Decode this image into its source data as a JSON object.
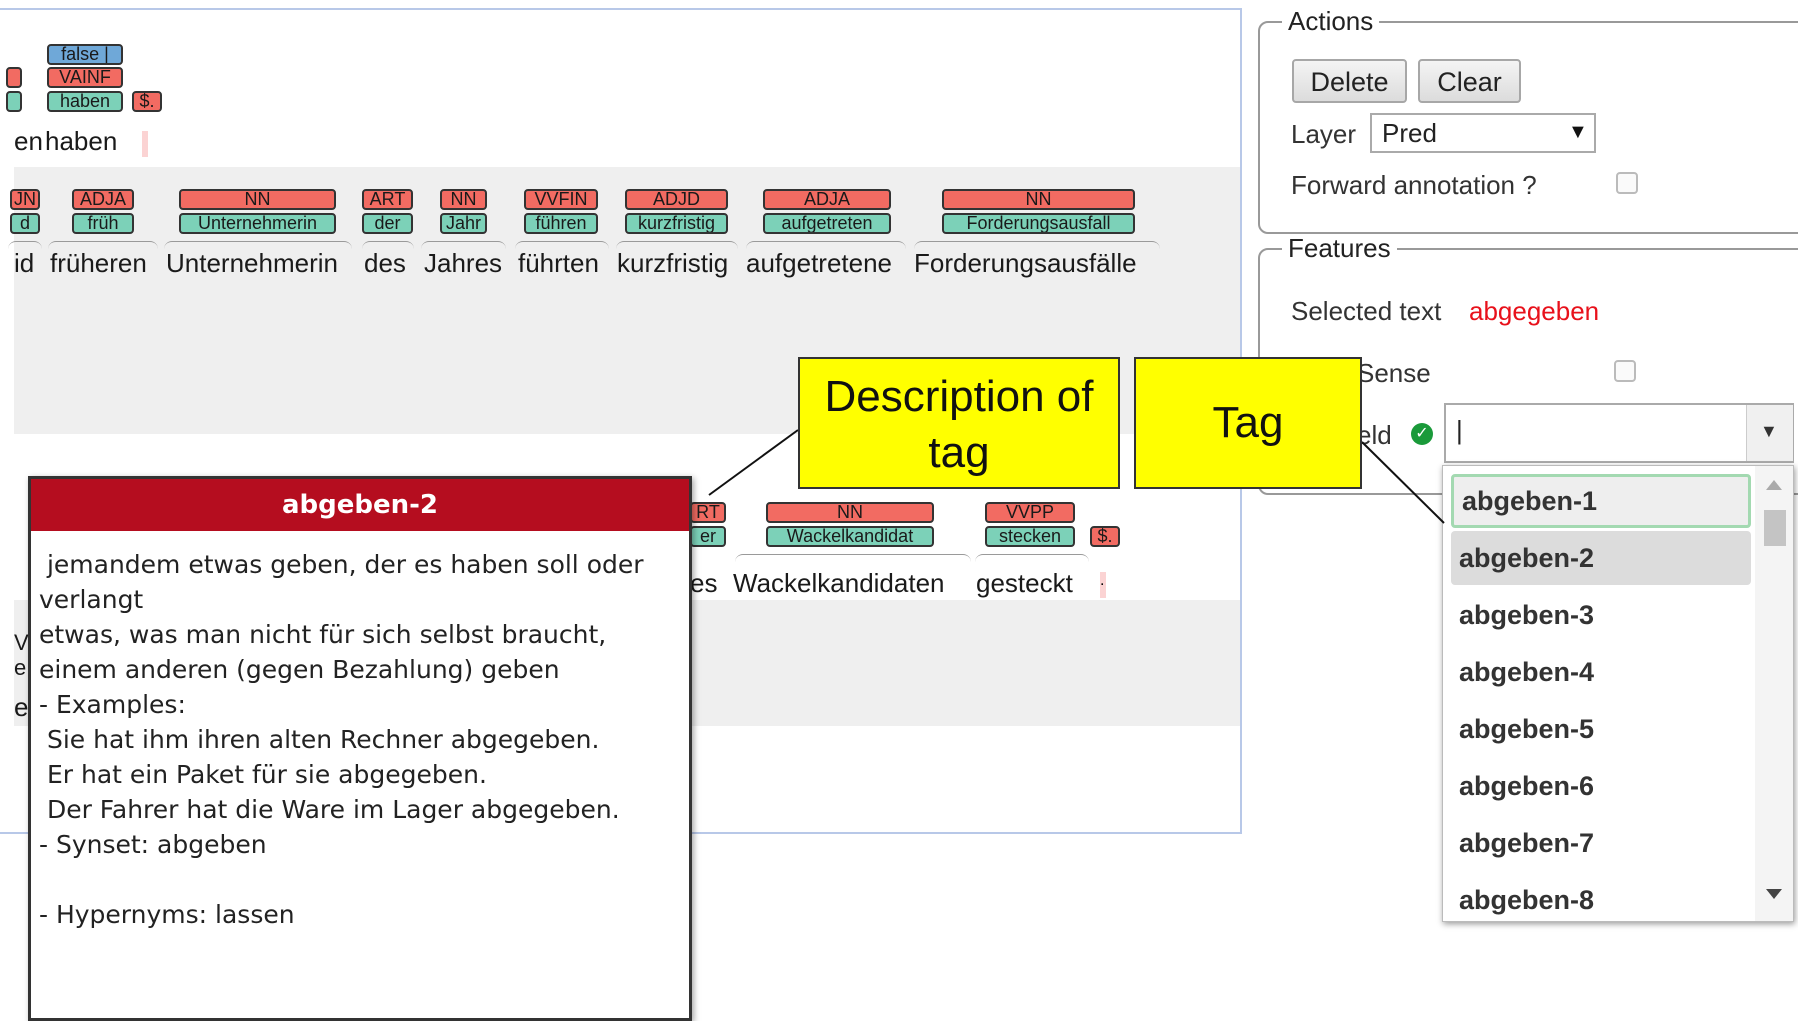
{
  "editor": {
    "row1": {
      "tags": [
        {
          "t": "false |",
          "k": "feat"
        },
        {
          "t": "VAINF",
          "k": "pos"
        },
        {
          "t": "haben",
          "k": "lem"
        },
        {
          "t": "$.",
          "k": "pos"
        }
      ],
      "tokens": [
        "en",
        "haben",
        "."
      ]
    },
    "row2": {
      "pos": [
        "JN",
        "ADJA",
        "NN",
        "ART",
        "NN",
        "VVFIN",
        "ADJD",
        "ADJA",
        "NN"
      ],
      "lemma": [
        "d",
        "früh",
        "Unternehmerin",
        "der",
        "Jahr",
        "führen",
        "kurzfristig",
        "aufgetreten",
        "Forderungsausfall"
      ],
      "tokens": [
        "id",
        "früheren",
        "Unternehmerin",
        "des",
        "Jahres",
        "führten",
        "kurzfristig",
        "aufgetretene",
        "Forderungsausfälle"
      ]
    },
    "row3": {
      "pos": [
        "RT",
        "NN",
        "VVPP",
        "$."
      ],
      "lemma": [
        "er",
        "Wackelkandidat",
        "stecken"
      ],
      "tokens": [
        "es",
        "Wackelkandidaten",
        "gesteckt",
        "."
      ]
    },
    "row4": {
      "frag": [
        "V",
        "e",
        "et"
      ]
    }
  },
  "actions": {
    "legend": "Actions",
    "delete": "Delete",
    "clear": "Clear",
    "layer_label": "Layer",
    "layer_value": "Pred",
    "forward_label": "Forward annotation ?"
  },
  "features": {
    "legend": "Features",
    "selected_label": "Selected text",
    "selected_value": "abgegeben",
    "sense_label": "Sense",
    "field_label": "eld",
    "input_value": "|"
  },
  "dropdown": {
    "options": [
      "abgeben-1",
      "abgeben-2",
      "abgeben-3",
      "abgeben-4",
      "abgeben-5",
      "abgeben-6",
      "abgeben-7",
      "abgeben-8"
    ]
  },
  "popup": {
    "title": "abgeben-2",
    "description": " jemandem etwas geben, der es haben soll oder verlangt\netwas, was man nicht für sich selbst braucht, einem anderen (gegen Bezahlung) geben\n- Examples:\n Sie hat ihm ihren alten Rechner abgegeben.\n Er hat ein Paket für sie abgegeben.\n Der Fahrer hat die Ware im Lager abgegeben.\n- Synset: abgeben\n\n- Hypernyms: lassen"
  },
  "callouts": {
    "desc": "Description of tag",
    "tag": "Tag"
  },
  "colors": {
    "pos": "#f26b62",
    "lemma": "#7cd1b8",
    "feature": "#6fa8d8",
    "popup_header": "#b50d1f",
    "callout": "#ffff00",
    "selected_text": "#e8111b"
  }
}
